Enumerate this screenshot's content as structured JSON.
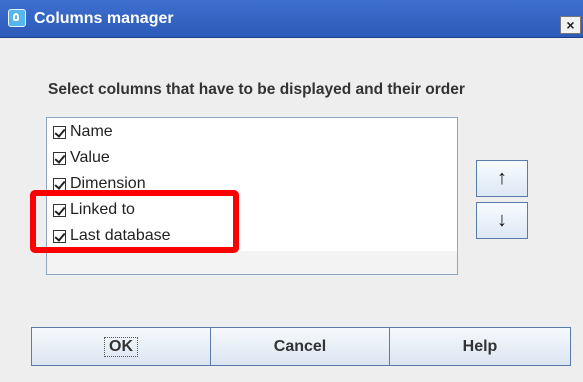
{
  "window": {
    "title": "Columns manager",
    "close_symbol": "×"
  },
  "instruction": "Select columns that have to be displayed and their order",
  "columns": [
    {
      "label": "Name",
      "checked": true
    },
    {
      "label": "Value",
      "checked": true
    },
    {
      "label": "Dimension",
      "checked": true
    },
    {
      "label": "Linked to",
      "checked": true
    },
    {
      "label": "Last database",
      "checked": true
    }
  ],
  "move_buttons": {
    "up_symbol": "↑",
    "down_symbol": "↓"
  },
  "footer": {
    "ok_label": "OK",
    "cancel_label": "Cancel",
    "help_label": "Help"
  },
  "colors": {
    "title_bar": "#2f60c2",
    "highlight": "#ff0000",
    "button_border": "#5a7aa8"
  },
  "icons": [
    "app-icon",
    "close-icon",
    "checkbox-checked-icon",
    "arrow-up-icon",
    "arrow-down-icon"
  ]
}
